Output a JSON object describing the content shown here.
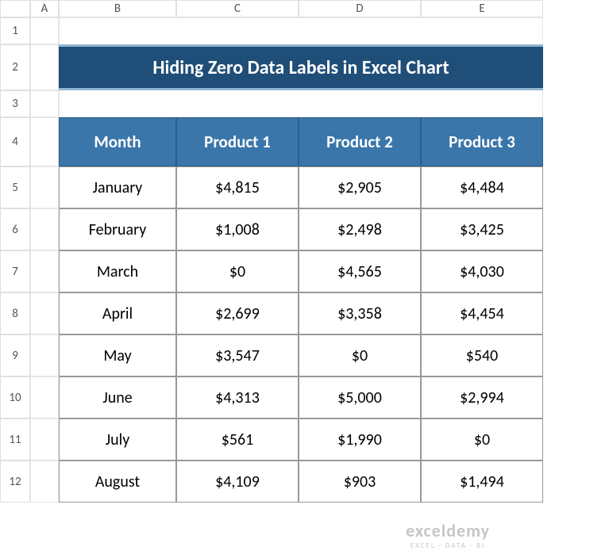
{
  "columns": [
    "A",
    "B",
    "C",
    "D",
    "E"
  ],
  "rows": [
    "1",
    "2",
    "3",
    "4",
    "5",
    "6",
    "7",
    "8",
    "9",
    "10",
    "11",
    "12"
  ],
  "title": "Hiding Zero Data Labels in Excel Chart",
  "table": {
    "headers": [
      "Month",
      "Product 1",
      "Product 2",
      "Product 3"
    ],
    "data": [
      [
        "January",
        "$4,815",
        "$2,905",
        "$4,484"
      ],
      [
        "February",
        "$1,008",
        "$2,498",
        "$3,425"
      ],
      [
        "March",
        "$0",
        "$4,565",
        "$4,030"
      ],
      [
        "April",
        "$2,699",
        "$3,358",
        "$4,454"
      ],
      [
        "May",
        "$3,547",
        "$0",
        "$540"
      ],
      [
        "June",
        "$4,313",
        "$5,000",
        "$2,994"
      ],
      [
        "July",
        "$561",
        "$1,990",
        "$0"
      ],
      [
        "August",
        "$4,109",
        "$903",
        "$1,494"
      ]
    ]
  },
  "watermark": {
    "brand": "exceldemy",
    "tagline": "EXCEL · DATA · BI"
  },
  "chart_data": {
    "type": "table",
    "title": "Hiding Zero Data Labels in Excel Chart",
    "categories": [
      "January",
      "February",
      "March",
      "April",
      "May",
      "June",
      "July",
      "August"
    ],
    "series": [
      {
        "name": "Product 1",
        "values": [
          4815,
          1008,
          0,
          2699,
          3547,
          4313,
          561,
          4109
        ]
      },
      {
        "name": "Product 2",
        "values": [
          2905,
          2498,
          4565,
          3358,
          0,
          5000,
          1990,
          903
        ]
      },
      {
        "name": "Product 3",
        "values": [
          4484,
          3425,
          4030,
          4454,
          540,
          2994,
          0,
          1494
        ]
      }
    ],
    "xlabel": "Month",
    "ylabel": ""
  }
}
